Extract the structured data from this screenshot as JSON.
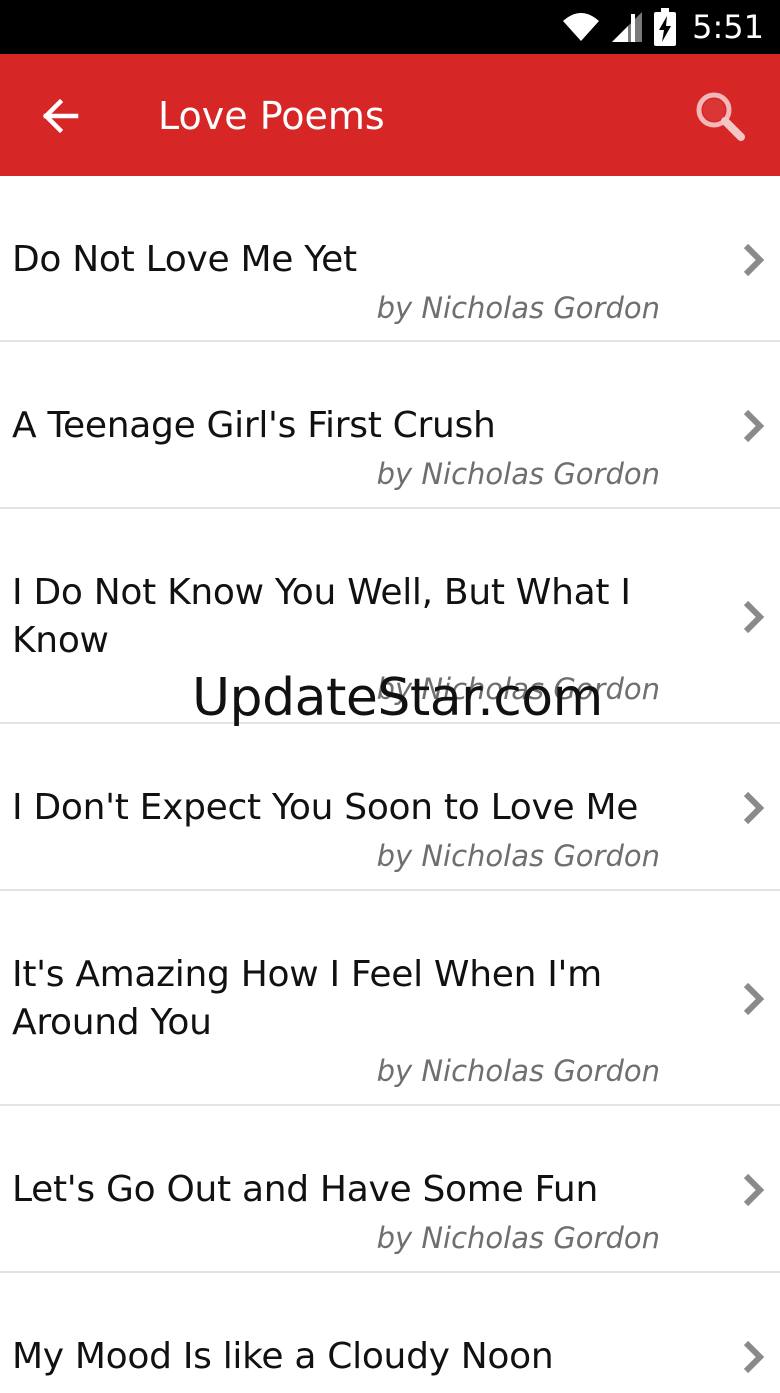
{
  "status_bar": {
    "time": "5:51",
    "icons": [
      "wifi-icon",
      "signal-icon",
      "battery-charging-icon"
    ]
  },
  "app_bar": {
    "title": "Love Poems",
    "back_icon": "arrow-left-icon",
    "search_icon": "search-icon"
  },
  "poems": [
    {
      "title": "Do Not Love Me Yet",
      "author": "by Nicholas Gordon"
    },
    {
      "title": "A Teenage Girl's First Crush",
      "author": "by Nicholas Gordon"
    },
    {
      "title": "I Do Not Know You Well, But What I Know",
      "author": "by Nicholas Gordon"
    },
    {
      "title": "I Don't Expect You Soon to Love Me",
      "author": "by Nicholas Gordon"
    },
    {
      "title": "It's Amazing How I Feel When I'm Around You",
      "author": "by Nicholas Gordon"
    },
    {
      "title": "Let's Go Out and Have Some Fun",
      "author": "by Nicholas Gordon"
    },
    {
      "title": "My Mood Is like a Cloudy Noon",
      "author": ""
    }
  ],
  "watermark": "UpdateStar.com",
  "colors": {
    "app_bar": "#d72626",
    "status_bar": "#000000",
    "title_text": "#111111",
    "author_text": "#6f6f6f",
    "divider": "#e3e3e3",
    "chevron": "#8a8a8a"
  }
}
